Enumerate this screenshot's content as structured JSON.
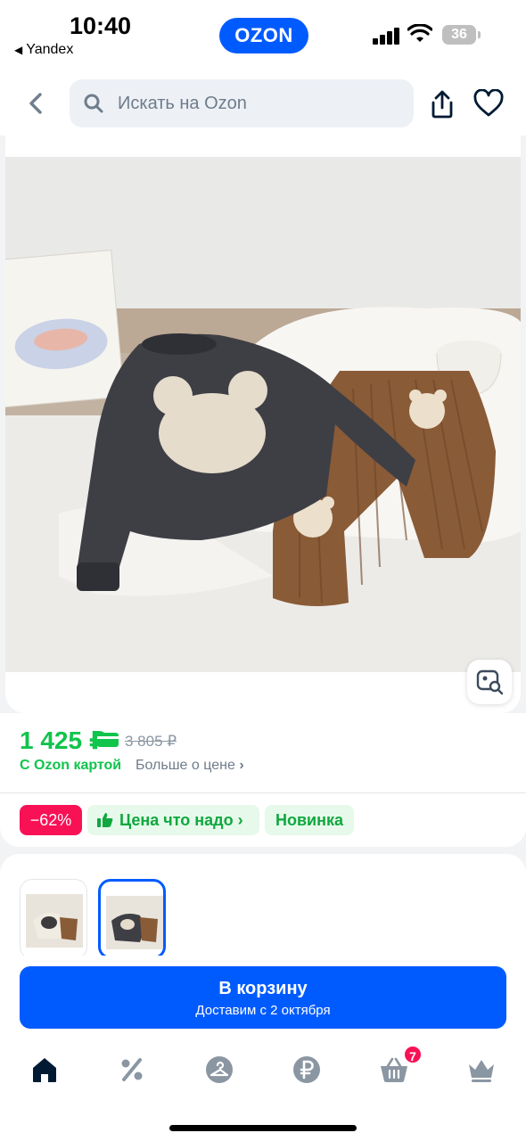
{
  "status_bar": {
    "time": "10:40",
    "back_app": "Yandex",
    "app_badge": "OZON",
    "battery": "36"
  },
  "header": {
    "search_placeholder": "Искать на Ozon",
    "icons": [
      "back-icon",
      "search-icon",
      "share-icon",
      "heart-icon"
    ]
  },
  "product": {
    "price": "1 425 ₽",
    "old_price": "3 805 ₽",
    "ozon_card_label": "С Ozon картой",
    "more_price_label": "Больше о цене",
    "badges": {
      "discount": "−62%",
      "good_price": "Цена что надо",
      "new": "Новинка"
    }
  },
  "cart": {
    "button_label": "В корзину",
    "delivery": "Доставим с 2 октября"
  },
  "tabbar": {
    "cart_count": "7",
    "tabs": [
      "home-icon",
      "percent-icon",
      "hanger-icon",
      "ruble-icon",
      "basket-icon",
      "crown-icon"
    ]
  },
  "colors": {
    "accent": "#005bff",
    "price_green": "#10c44c",
    "discount_red": "#f91155"
  }
}
